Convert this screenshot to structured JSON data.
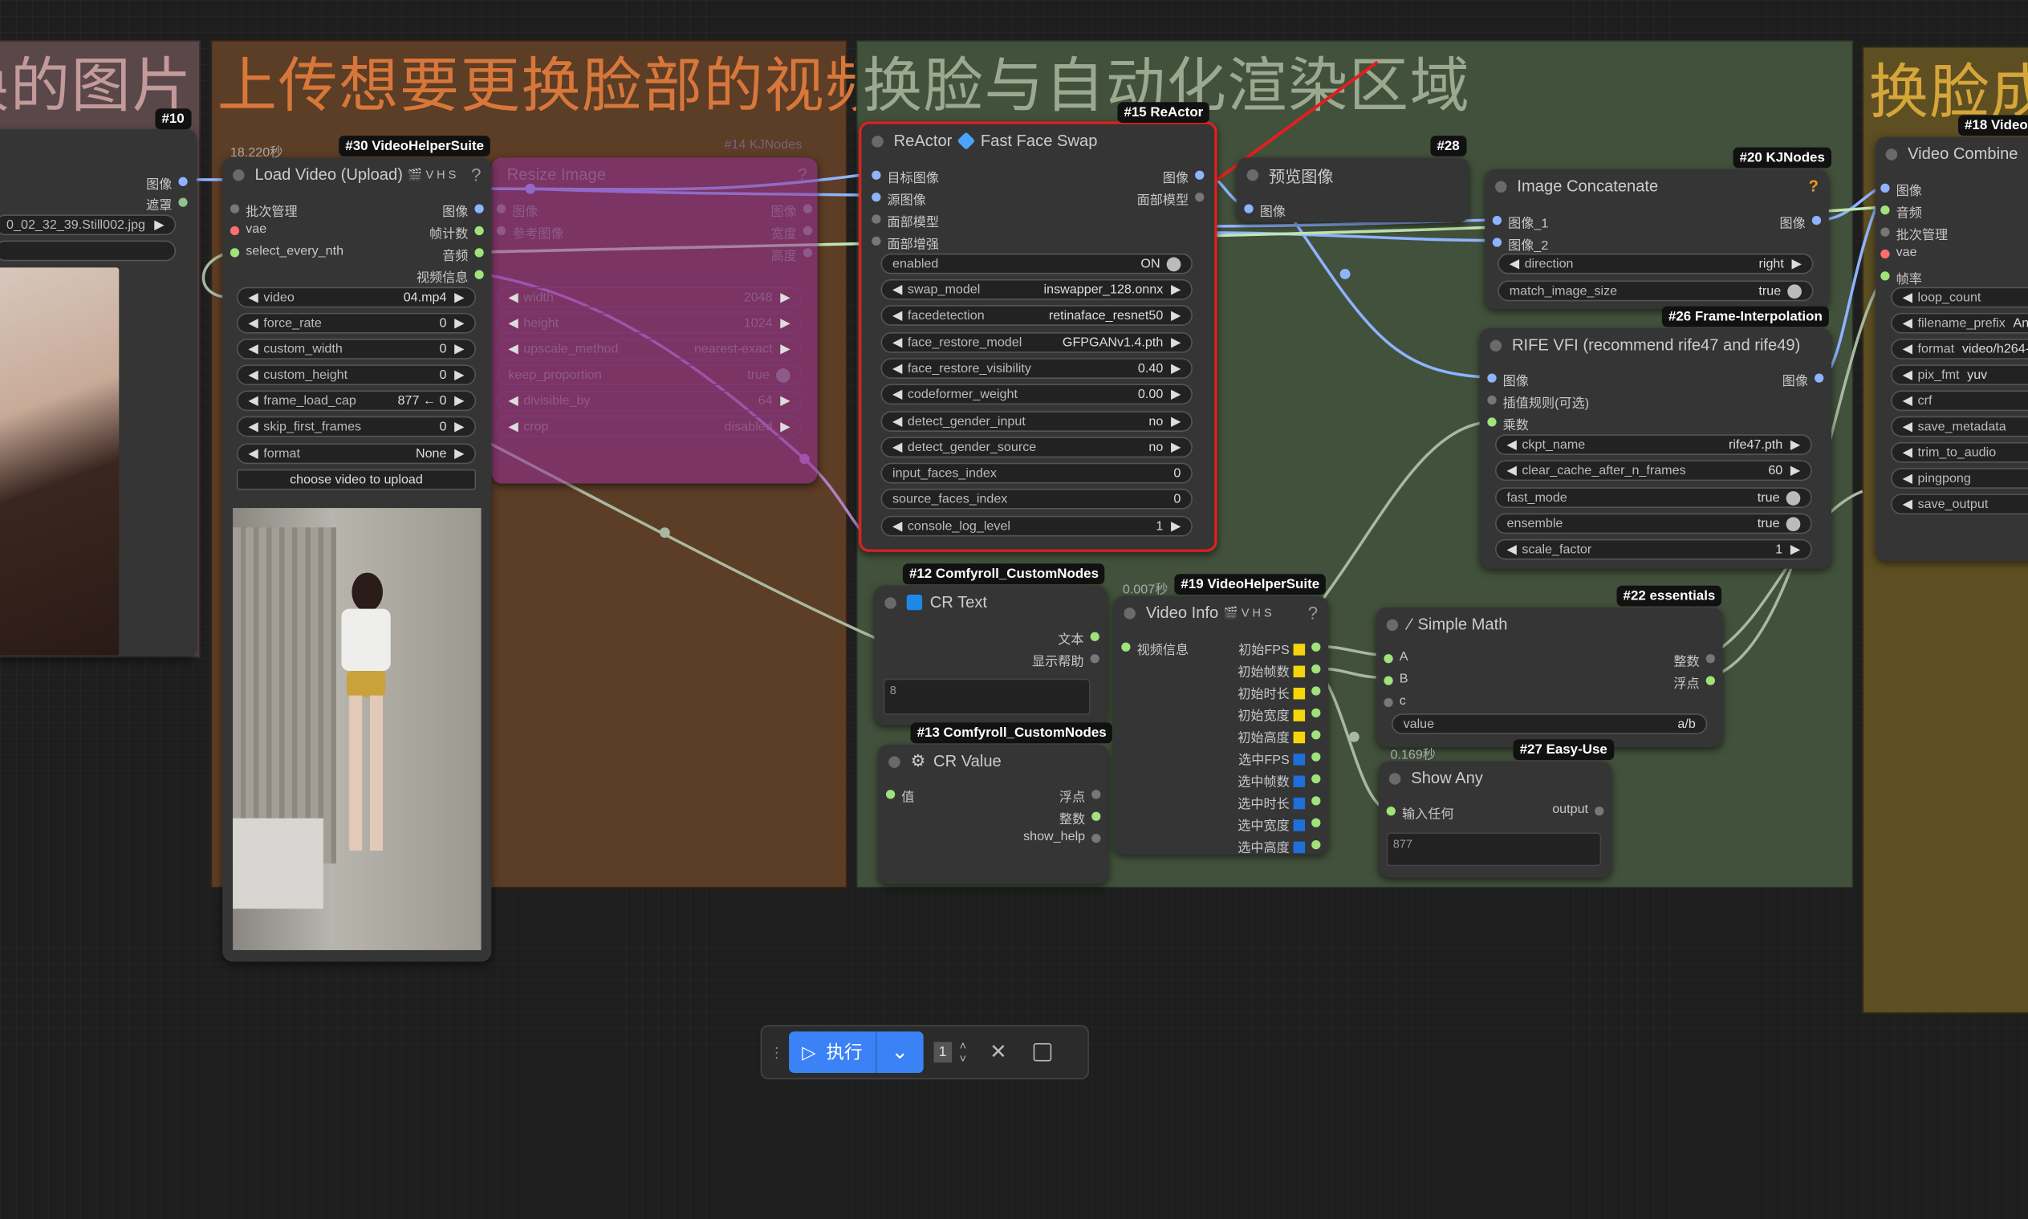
{
  "groups": {
    "image_group": {
      "title": "换的图片",
      "badge": "#10"
    },
    "video_group": {
      "title": "上传想要更换脸部的视频"
    },
    "render_group": {
      "title": "换脸与自动化渲染区域"
    },
    "output_group": {
      "title": "换脸成"
    }
  },
  "load_image": {
    "outputs": [
      "图像",
      "遮罩"
    ],
    "file_value": "0_02_32_39.Still002.jpg"
  },
  "load_video": {
    "badge": "#30 VideoHelperSuite",
    "time": "18.220秒",
    "title": "Load Video (Upload)",
    "title_icons": "🎬 V H S",
    "help": "?",
    "inputs": [
      "批次管理",
      "vae",
      "select_every_nth"
    ],
    "outputs": [
      "图像",
      "帧计数",
      "音频",
      "视频信息"
    ],
    "widgets": [
      {
        "label": "video",
        "value": "04.mp4"
      },
      {
        "label": "force_rate",
        "value": "0"
      },
      {
        "label": "custom_width",
        "value": "0"
      },
      {
        "label": "custom_height",
        "value": "0"
      },
      {
        "label": "frame_load_cap",
        "value": "877 ← 0"
      },
      {
        "label": "skip_first_frames",
        "value": "0"
      },
      {
        "label": "format",
        "value": "None"
      }
    ],
    "upload_label": "choose video to upload"
  },
  "resize_image": {
    "badge": "#14 KJNodes",
    "title": "Resize Image",
    "help": "?",
    "inputs": [
      "图像",
      "参考图像"
    ],
    "outputs": [
      "图像",
      "宽度",
      "高度"
    ],
    "widgets": [
      {
        "label": "width",
        "value": "2048"
      },
      {
        "label": "height",
        "value": "1024"
      },
      {
        "label": "upscale_method",
        "value": "nearest-exact"
      },
      {
        "label": "keep_proportion",
        "value": "true"
      },
      {
        "label": "divisible_by",
        "value": "64"
      },
      {
        "label": "crop",
        "value": "disabled"
      }
    ]
  },
  "reactor": {
    "badge": "#15 ReActor",
    "title": "ReActor",
    "title_suffix": "Fast Face Swap",
    "inputs": [
      "目标图像",
      "源图像",
      "面部模型",
      "面部增强"
    ],
    "outputs": [
      "图像",
      "面部模型"
    ],
    "enabled_label": "enabled",
    "enabled_value": "ON",
    "widgets": [
      {
        "label": "swap_model",
        "value": "inswapper_128.onnx"
      },
      {
        "label": "facedetection",
        "value": "retinaface_resnet50"
      },
      {
        "label": "face_restore_model",
        "value": "GFPGANv1.4.pth"
      },
      {
        "label": "face_restore_visibility",
        "value": "0.40"
      },
      {
        "label": "codeformer_weight",
        "value": "0.00"
      },
      {
        "label": "detect_gender_input",
        "value": "no"
      },
      {
        "label": "detect_gender_source",
        "value": "no"
      },
      {
        "label": "input_faces_index",
        "value": "0"
      },
      {
        "label": "source_faces_index",
        "value": "0"
      },
      {
        "label": "console_log_level",
        "value": "1"
      }
    ]
  },
  "preview": {
    "badge": "#28",
    "title": "预览图像",
    "inputs": [
      "图像"
    ]
  },
  "concat": {
    "badge": "#20 KJNodes",
    "title": "Image Concatenate",
    "help": "?",
    "inputs": [
      "图像_1",
      "图像_2"
    ],
    "outputs": [
      "图像"
    ],
    "widgets": [
      {
        "label": "direction",
        "value": "right"
      },
      {
        "label": "match_image_size",
        "value": "true"
      }
    ]
  },
  "rife": {
    "badge": "#26 Frame-Interpolation",
    "title": "RIFE VFI (recommend rife47 and rife49)",
    "inputs": [
      "图像",
      "插值规则(可选)",
      "乘数"
    ],
    "outputs": [
      "图像"
    ],
    "widgets": [
      {
        "label": "ckpt_name",
        "value": "rife47.pth"
      },
      {
        "label": "clear_cache_after_n_frames",
        "value": "60"
      },
      {
        "label": "fast_mode",
        "value": "true"
      },
      {
        "label": "ensemble",
        "value": "true"
      },
      {
        "label": "scale_factor",
        "value": "1"
      }
    ]
  },
  "cr_text": {
    "badge": "#12 Comfyroll_CustomNodes",
    "title": "CR Text",
    "outputs": [
      "文本",
      "显示帮助"
    ],
    "text_value": "8"
  },
  "cr_value": {
    "badge": "#13 Comfyroll_CustomNodes",
    "title": "CR Value",
    "inputs": [
      "值"
    ],
    "outputs": [
      "浮点",
      "整数",
      "show_help"
    ]
  },
  "video_info": {
    "badge": "#19 VideoHelperSuite",
    "time": "0.007秒",
    "title": "Video Info",
    "title_icons": "🎬 V H S",
    "help": "?",
    "inputs": [
      "视频信息"
    ],
    "outputs": [
      "初始FPS",
      "初始帧数",
      "初始时长",
      "初始宽度",
      "初始高度",
      "选中FPS",
      "选中帧数",
      "选中时长",
      "选中宽度",
      "选中高度"
    ]
  },
  "simple_math": {
    "badge": "#22 essentials",
    "title": "Simple Math",
    "inputs": [
      "A",
      "B",
      "c"
    ],
    "outputs": [
      "整数",
      "浮点"
    ],
    "value_label": "value",
    "value": "a/b"
  },
  "show_any": {
    "badge": "#27 Easy-Use",
    "time": "0.169秒",
    "title": "Show Any",
    "inputs": [
      "输入任何"
    ],
    "outputs": [
      "output"
    ],
    "text_value": "877"
  },
  "video_combine": {
    "badge": "#18 Video",
    "title": "Video Combine",
    "inputs": [
      "图像",
      "音频",
      "批次管理",
      "vae",
      "帧率"
    ],
    "widgets": [
      {
        "label": "loop_count",
        "value": ""
      },
      {
        "label": "filename_prefix",
        "value": "Ani"
      },
      {
        "label": "format",
        "value": "video/h264-"
      },
      {
        "label": "pix_fmt",
        "value": "yuv"
      },
      {
        "label": "crf",
        "value": ""
      },
      {
        "label": "save_metadata",
        "value": ""
      },
      {
        "label": "trim_to_audio",
        "value": ""
      },
      {
        "label": "pingpong",
        "value": ""
      },
      {
        "label": "save_output",
        "value": ""
      }
    ]
  },
  "toolbar": {
    "run_label": "执行",
    "batch_value": "1"
  },
  "colors": {
    "image_edge": "#8fb3ff",
    "audio_edge": "#bfe6b0",
    "group_image": "#6b4f52",
    "group_video": "#6b4328",
    "group_render": "#44533c",
    "group_output": "#6b5a24",
    "highlight_red": "#e02020"
  }
}
